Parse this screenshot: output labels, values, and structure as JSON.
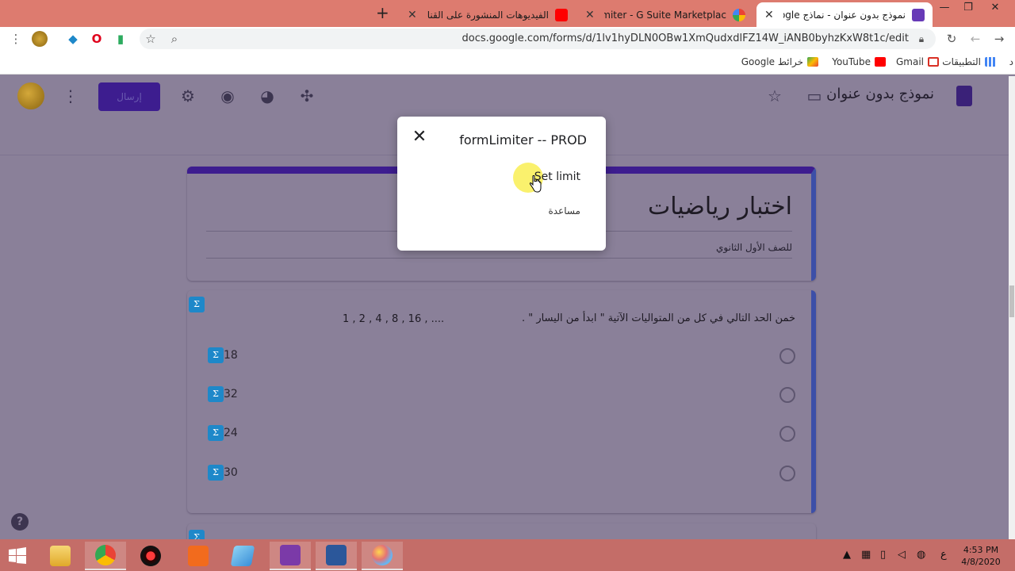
{
  "browser": {
    "tabs": [
      {
        "title": "نموذج بدون عنوان - نماذج Google",
        "active": true,
        "icon": "forms-icon"
      },
      {
        "title": "formLimiter - G Suite Marketplac",
        "active": false,
        "icon": "marketplace-icon"
      },
      {
        "title": "الفيديوهات المنشورة على القناة -",
        "active": false,
        "icon": "youtube-icon"
      }
    ],
    "new_tab_label": "+",
    "url": "docs.google.com/forms/d/1lv1hyDLN0OBw1XmQudxdlFZ14W_iANB0byhzKxW8t1c/edit",
    "bookmarks": [
      {
        "label": "التطبيقات",
        "icon": "apps-grid-icon"
      },
      {
        "label": "Gmail",
        "icon": "gmail-icon"
      },
      {
        "label": "YouTube",
        "icon": "youtube-icon"
      },
      {
        "label": "خرائط Google",
        "icon": "maps-icon"
      }
    ],
    "bookmark_overflow": "د"
  },
  "forms_header": {
    "doc_title": "نموذج بدون عنوان",
    "send_label": "إرسال"
  },
  "form": {
    "title": "اختبار رياضيات",
    "description": "للصف الأول الثانوي",
    "question": {
      "text": "خمن الحد التالي في كل من المتواليات الآتية \" ابدأ من اليسار \" .",
      "sequence": "1 , 2 , 4 , 8 , 16 , ....",
      "options": [
        "18",
        "32",
        "24",
        "30"
      ]
    }
  },
  "popup": {
    "title": "formLimiter -- PROD",
    "set_limit": "Set limit",
    "help": "مساعدة"
  },
  "help_button": "?",
  "taskbar": {
    "time": "4:53 PM",
    "date": "4/8/2020",
    "lang": "ع"
  },
  "colors": {
    "tab_strip": "#dd7b6f",
    "overlay": "#8a8099",
    "accent_purple": "#3d1d8f",
    "taskbar": "#c46d68",
    "math_badge": "#1e88c9"
  }
}
